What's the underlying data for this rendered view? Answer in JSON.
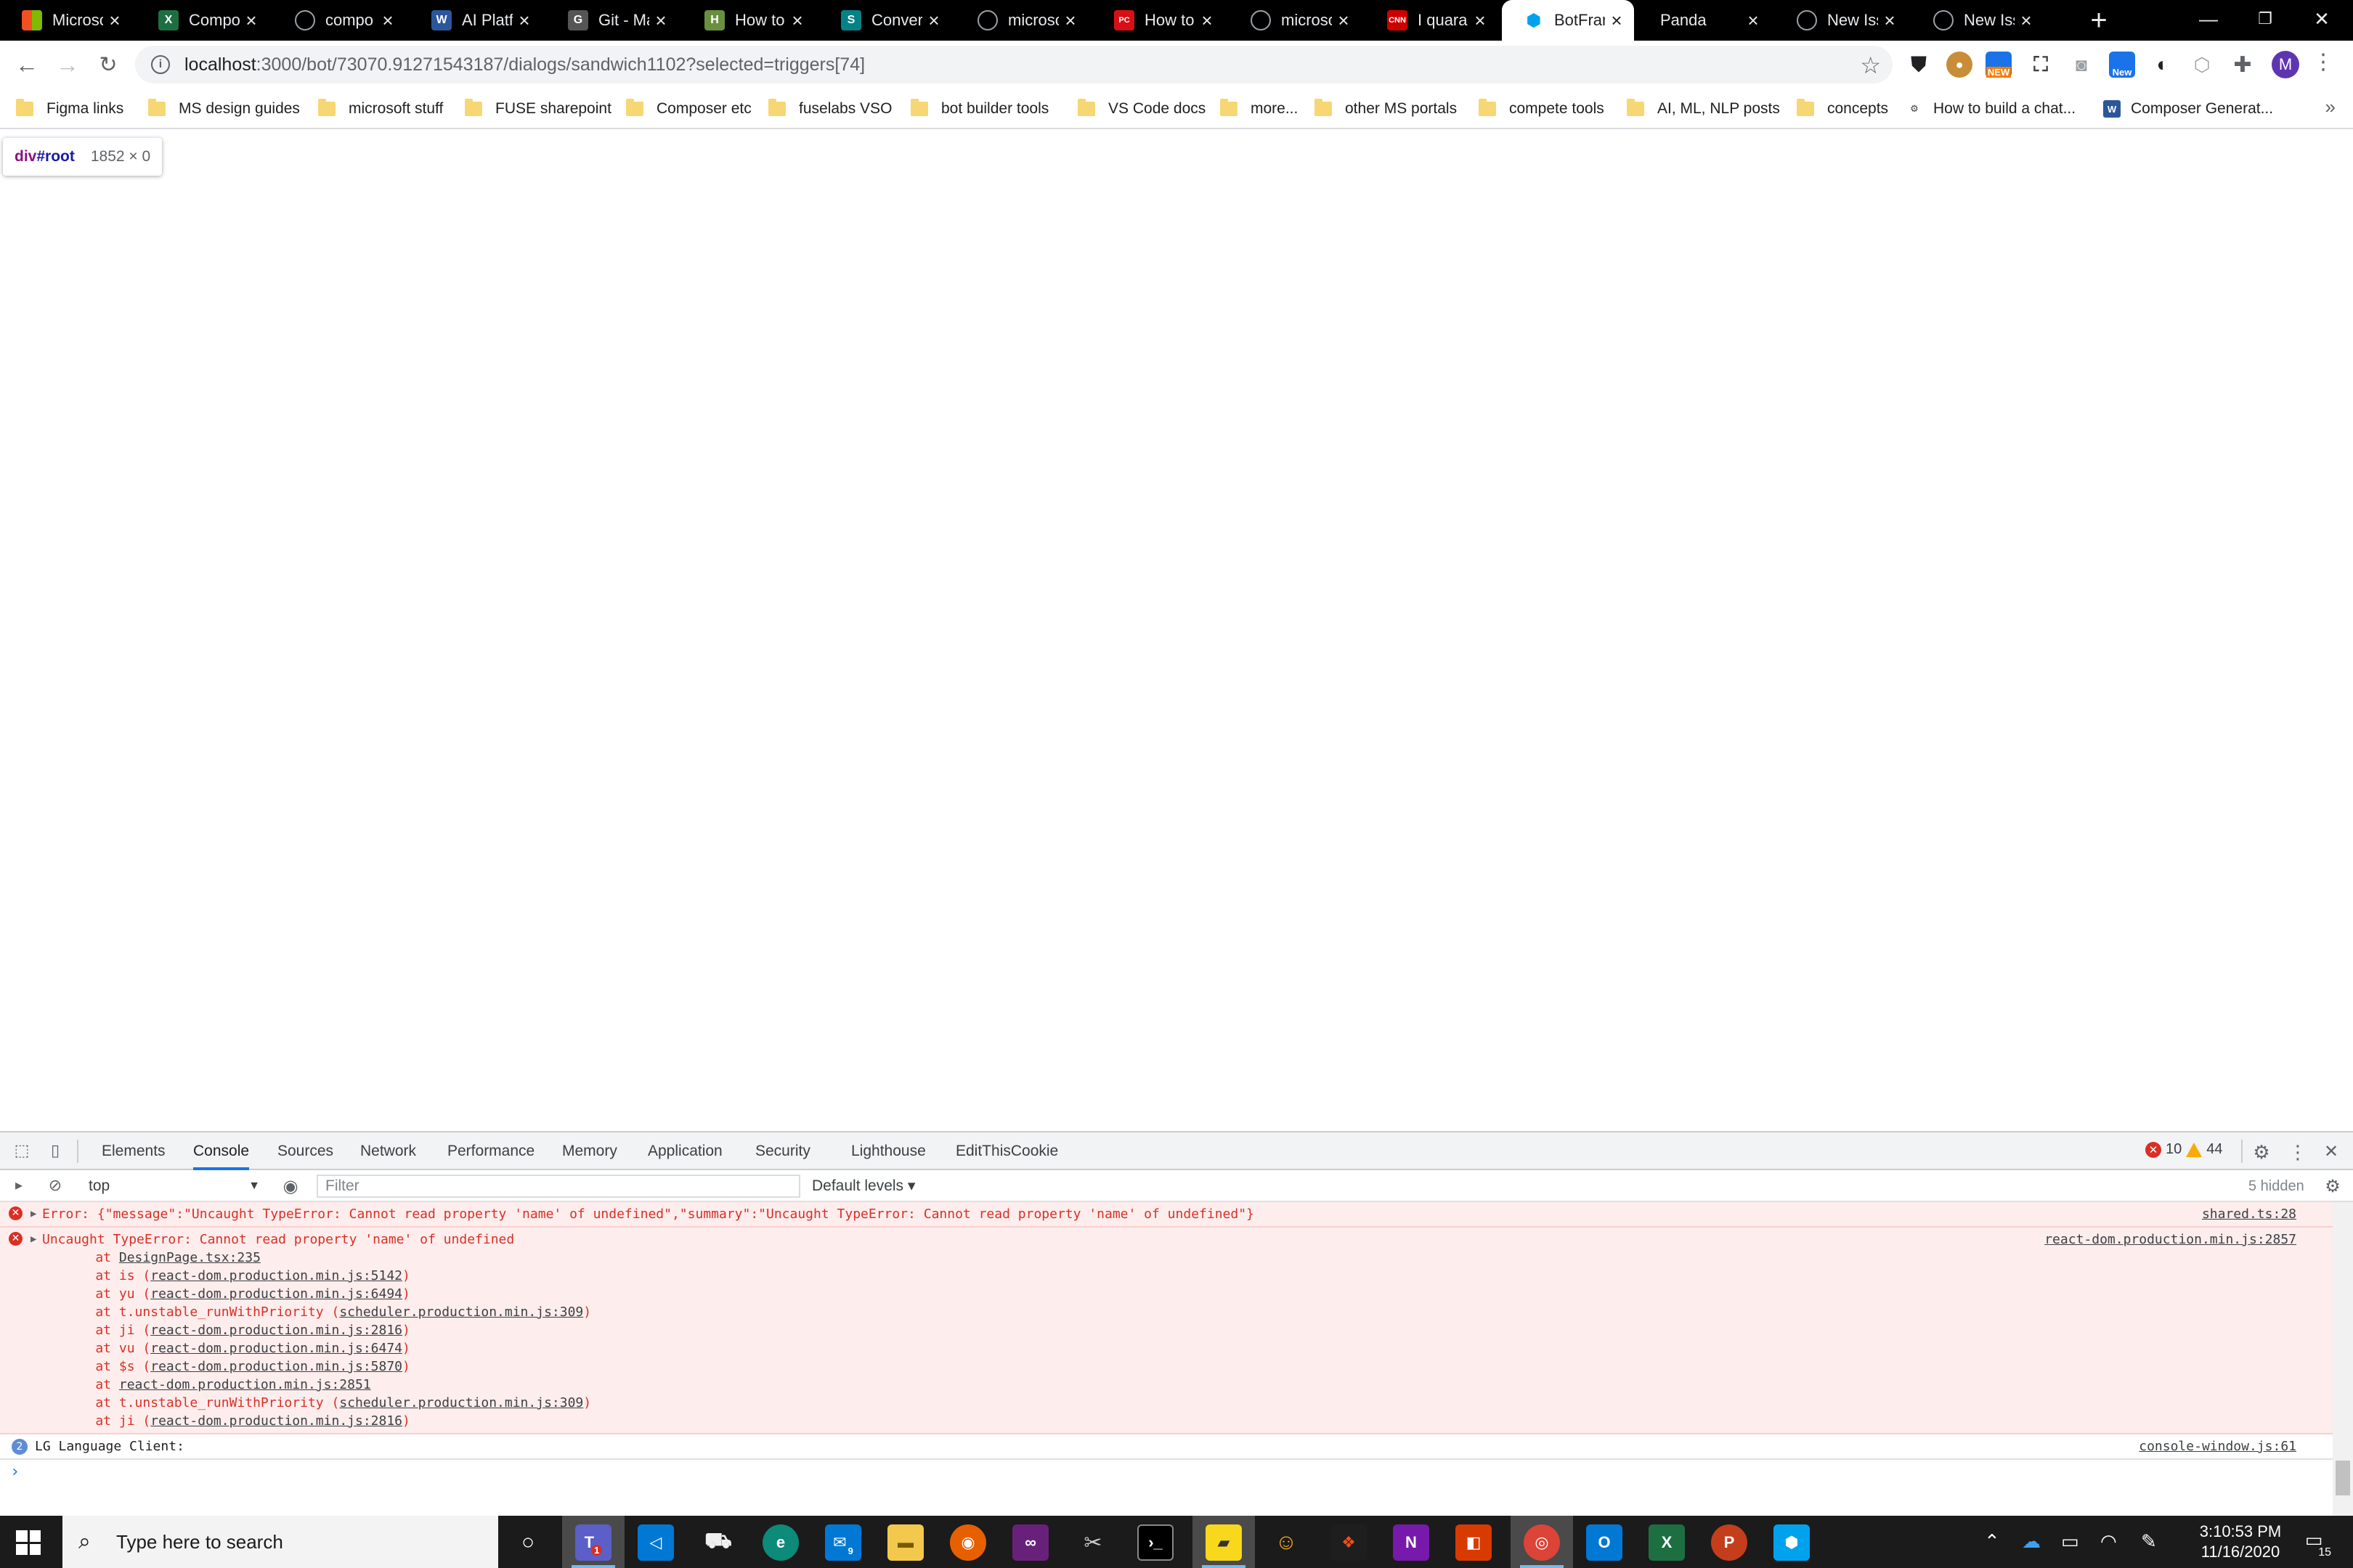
{
  "tabs": [
    {
      "title": "Microso",
      "fav": "ms",
      "color": "#f25022"
    },
    {
      "title": "Compo",
      "fav": "X",
      "color": "#1d6f42"
    },
    {
      "title": "compo",
      "fav": "gh",
      "color": "#24292e"
    },
    {
      "title": "AI Platfo",
      "fav": "W",
      "color": "#2b579a"
    },
    {
      "title": "Git - Ma",
      "fav": "G",
      "color": "#555555"
    },
    {
      "title": "How to",
      "fav": "H",
      "color": "#6a8f3f"
    },
    {
      "title": "Convers",
      "fav": "S",
      "color": "#038387"
    },
    {
      "title": "microso",
      "fav": "gh",
      "color": "#24292e"
    },
    {
      "title": "How to",
      "fav": "PC",
      "color": "#d80f16"
    },
    {
      "title": "microso",
      "fav": "gh",
      "color": "#24292e"
    },
    {
      "title": "I quaran",
      "fav": "CNN",
      "color": "#cc0000"
    },
    {
      "title": "BotFram",
      "fav": "bf",
      "color": "#00a2ed",
      "active": true
    },
    {
      "title": "Panda",
      "fav": "",
      "color": ""
    },
    {
      "title": "New Iss",
      "fav": "gh",
      "color": "#24292e"
    },
    {
      "title": "New Iss",
      "fav": "gh",
      "color": "#24292e"
    }
  ],
  "toolbar": {
    "url_host": "localhost",
    "url_rest": ":3000/bot/73070.91271543187/dialogs/sandwich1102?selected=triggers[74]",
    "ext_new_1": "NEW",
    "ext_new_2": "New",
    "avatar_letter": "M"
  },
  "bookmarks": [
    {
      "label": "Figma links",
      "type": "folder"
    },
    {
      "label": "MS design guides",
      "type": "folder"
    },
    {
      "label": "microsoft stuff",
      "type": "folder"
    },
    {
      "label": "FUSE sharepoint",
      "type": "folder"
    },
    {
      "label": "Composer etc",
      "type": "folder"
    },
    {
      "label": "fuselabs VSO",
      "type": "folder"
    },
    {
      "label": "bot builder tools",
      "type": "folder"
    },
    {
      "label": "VS Code docs",
      "type": "folder"
    },
    {
      "label": "more...",
      "type": "folder"
    },
    {
      "label": "other MS portals",
      "type": "folder"
    },
    {
      "label": "compete tools",
      "type": "folder"
    },
    {
      "label": "AI, ML, NLP posts",
      "type": "folder"
    },
    {
      "label": "concepts",
      "type": "folder"
    },
    {
      "label": "How to build a chat...",
      "type": "link",
      "fav": "bot"
    },
    {
      "label": "Composer Generat...",
      "type": "link",
      "fav": "W"
    }
  ],
  "inspect": {
    "element": "div",
    "id": "#root",
    "dims": "1852 × 0"
  },
  "devtools": {
    "tabs": [
      "Elements",
      "Console",
      "Sources",
      "Network",
      "Performance",
      "Memory",
      "Application",
      "Security",
      "Lighthouse",
      "EditThisCookie"
    ],
    "active_tab": "Console",
    "error_count": "10",
    "warning_count": "44",
    "context": "top",
    "filter_placeholder": "Filter",
    "levels": "Default levels ▾",
    "hidden": "5 hidden",
    "messages": {
      "error1": {
        "text": "Error: {\"message\":\"Uncaught TypeError: Cannot read property 'name' of undefined\",\"summary\":\"Uncaught TypeError: Cannot read property 'name' of undefined\"}",
        "source": "shared.ts:28"
      },
      "error2": {
        "text": "Uncaught TypeError: Cannot read property 'name' of undefined",
        "source": "react-dom.production.min.js:2857",
        "stack": [
          {
            "fn": "",
            "loc": "DesignPage.tsx:235"
          },
          {
            "fn": "is",
            "loc": "react-dom.production.min.js:5142"
          },
          {
            "fn": "yu",
            "loc": "react-dom.production.min.js:6494"
          },
          {
            "fn": "t.unstable_runWithPriority",
            "loc": "scheduler.production.min.js:309"
          },
          {
            "fn": "ji",
            "loc": "react-dom.production.min.js:2816"
          },
          {
            "fn": "vu",
            "loc": "react-dom.production.min.js:6474"
          },
          {
            "fn": "$s",
            "loc": "react-dom.production.min.js:5870"
          },
          {
            "fn": "",
            "loc": "react-dom.production.min.js:2851"
          },
          {
            "fn": "t.unstable_runWithPriority",
            "loc": "scheduler.production.min.js:309"
          },
          {
            "fn": "ji",
            "loc": "react-dom.production.min.js:2816"
          }
        ]
      },
      "info1": {
        "badge": "2",
        "text": "LG Language Client:",
        "source": "console-window.js:61"
      }
    }
  },
  "taskbar": {
    "search_placeholder": "Type here to search",
    "teams_badge": "1",
    "mail_badge": "9",
    "time": "3:10:53 PM",
    "date": "11/16/2020",
    "notif_count": "15"
  }
}
